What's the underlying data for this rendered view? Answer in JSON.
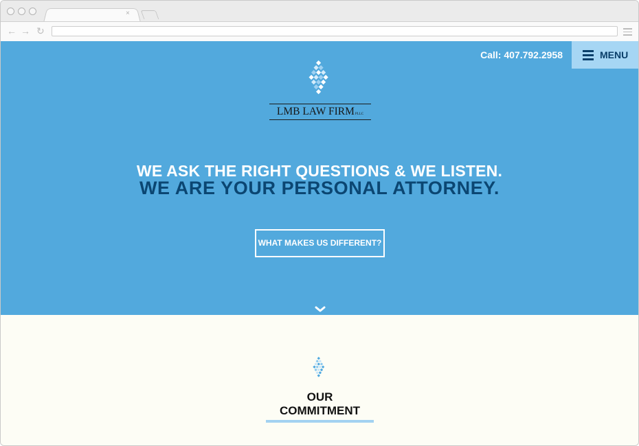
{
  "browser": {
    "tab_close": "×",
    "back_glyph": "←",
    "forward_glyph": "→",
    "reload_glyph": "↻",
    "url": ""
  },
  "header": {
    "call_text": "Call: 407.792.2958",
    "menu_label": "MENU"
  },
  "logo": {
    "name": "LMB LAW FIRM",
    "suffix": "PLLC"
  },
  "hero": {
    "line1": "WE ASK THE RIGHT QUESTIONS & WE LISTEN.",
    "line2": "WE ARE YOUR PERSONAL ATTORNEY.",
    "cta_label": "WHAT MAKES US DIFFERENT?",
    "scroll_icon": "chevron-down-icon"
  },
  "commitment": {
    "title": "OUR COMMITMENT",
    "icon": "diamond-cluster-icon"
  },
  "colors": {
    "hero_bg": "#52a9dd",
    "headline_dark": "#0b4672",
    "menu_bg": "#a6d6f4",
    "section_bg": "#fdfdf5",
    "underline": "#a3d2f1"
  }
}
